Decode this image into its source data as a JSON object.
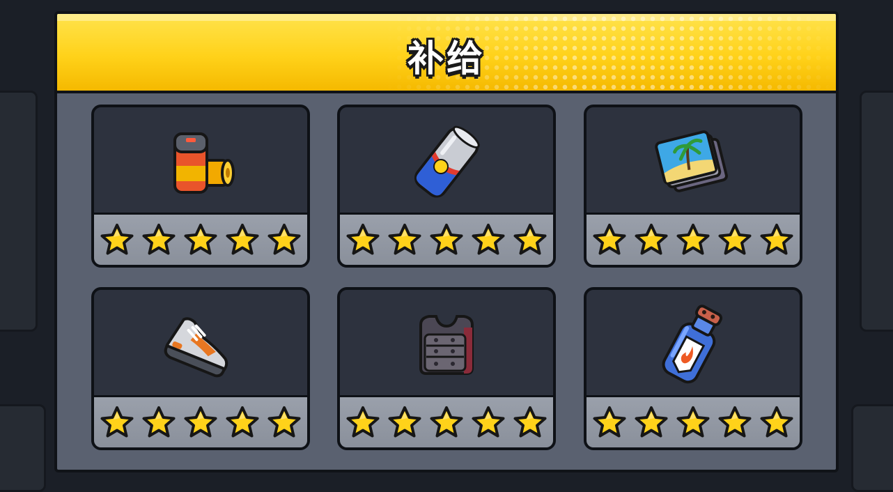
{
  "title": "补给",
  "star_count": 5,
  "colors": {
    "header": "#ffd21a",
    "panel": "#5a6170",
    "card": "#2d323e",
    "star_fill": "#ffd21a",
    "star_bar": "#9aa0ab"
  },
  "supplies": [
    {
      "icon": "battery-pack-icon",
      "stars": 5
    },
    {
      "icon": "energy-can-icon",
      "stars": 5
    },
    {
      "icon": "magazine-icon",
      "stars": 5
    },
    {
      "icon": "sneaker-icon",
      "stars": 5
    },
    {
      "icon": "body-armor-icon",
      "stars": 5
    },
    {
      "icon": "fire-bottle-icon",
      "stars": 5
    }
  ]
}
